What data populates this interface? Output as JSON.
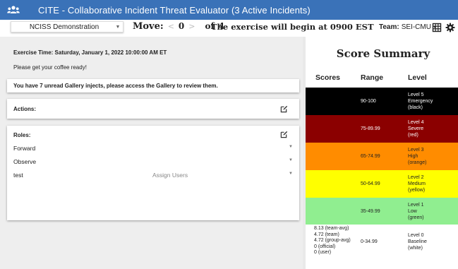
{
  "app": {
    "title": "CITE - Collaborative Incident Threat Evaluator (3 Active Incidents)",
    "bar_color": "#3a72b8"
  },
  "toolbar": {
    "scenario": "NCISS Demonstration",
    "move_label": "Move:",
    "move_prev": "<",
    "move_current": "0",
    "move_next": ">",
    "move_of": "of",
    "move_total": "4",
    "exercise_message": "The exercise will begin at 0900 EST",
    "team_label": "Team:",
    "team_value": "SEI-CMU",
    "icons": [
      "team-icon",
      "grid-icon",
      "gear-icon",
      "caret-down-icon"
    ]
  },
  "left": {
    "exercise_time": "Exercise Time: Saturday, January 1, 2022 10:00:00 AM ET",
    "message": "Please get your coffee ready!",
    "gallery_notice": "You have 7 unread Gallery injects, please access the Gallery to review them.",
    "actions_title": "Actions:",
    "roles_title": "Roles:",
    "roles": [
      {
        "name": "Forward",
        "assign": ""
      },
      {
        "name": "Observe",
        "assign": ""
      },
      {
        "name": "test",
        "assign": "Assign Users"
      }
    ]
  },
  "score_summary": {
    "title": "Score Summary",
    "headers": {
      "scores": "Scores",
      "range": "Range",
      "level": "Level"
    },
    "rows": [
      {
        "score": "",
        "range": "90-100",
        "level_line1": "Level 5",
        "level_line2": "Emergency",
        "level_line3": "(black)",
        "bg": "#000000",
        "fg": "#ffffff"
      },
      {
        "score": "",
        "range": "75-89.99",
        "level_line1": "Level 4",
        "level_line2": "Severe",
        "level_line3": "(red)",
        "bg": "#8b0000",
        "fg": "#ffffff"
      },
      {
        "score": "",
        "range": "65-74.99",
        "level_line1": "Level 3",
        "level_line2": "High",
        "level_line3": "(orange)",
        "bg": "#ff8c00",
        "fg": "#222222"
      },
      {
        "score": "",
        "range": "50-64.99",
        "level_line1": "Level 2",
        "level_line2": "Medium",
        "level_line3": "(yellow)",
        "bg": "#ffff00",
        "fg": "#222222"
      },
      {
        "score": "",
        "range": "35-49.99",
        "level_line1": "Level 1",
        "level_line2": "Low",
        "level_line3": "(green)",
        "bg": "#90ee90",
        "fg": "#222222"
      }
    ],
    "baseline": {
      "scores": [
        "8.13 (team-avg)",
        "4.72 (team)",
        "4.72 (group-avg)",
        "0 (official)",
        "0 (user)"
      ],
      "range": "0-34.99",
      "level_line1": "Level 0",
      "level_line2": "Baseline",
      "level_line3": "(white)"
    }
  }
}
